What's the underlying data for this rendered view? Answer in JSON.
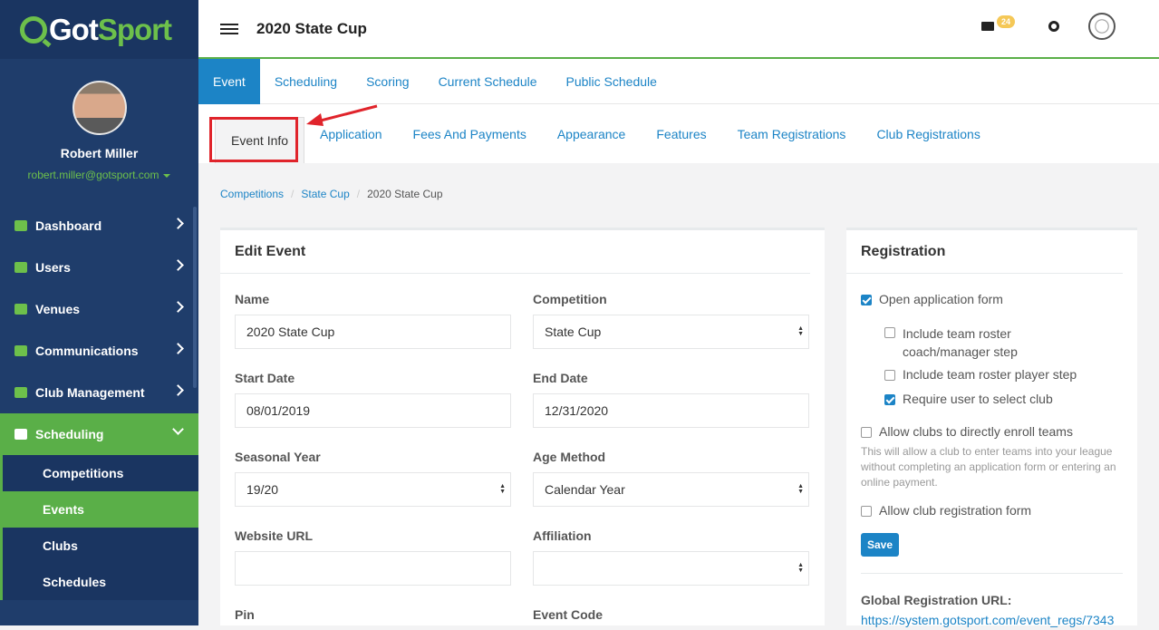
{
  "brand": {
    "got": "Got",
    "sport": "Sport"
  },
  "user": {
    "name": "Robert Miller",
    "email": "robert.miller@gotsport.com"
  },
  "nav": [
    {
      "label": "Dashboard",
      "icon": "dashboard-icon"
    },
    {
      "label": "Users",
      "icon": "users-icon"
    },
    {
      "label": "Venues",
      "icon": "home-icon"
    },
    {
      "label": "Communications",
      "icon": "chat-icon"
    },
    {
      "label": "Club Management",
      "icon": "list-icon"
    },
    {
      "label": "Scheduling",
      "icon": "calendar-icon"
    }
  ],
  "subnav": [
    "Competitions",
    "Events",
    "Clubs",
    "Schedules"
  ],
  "header": {
    "title": "2020 State Cup",
    "mail_count": "24"
  },
  "tabs_primary": [
    "Event",
    "Scheduling",
    "Scoring",
    "Current Schedule",
    "Public Schedule"
  ],
  "tabs_secondary": [
    "Event Info",
    "Application",
    "Fees And Payments",
    "Appearance",
    "Features",
    "Team Registrations",
    "Club Registrations"
  ],
  "breadcrumb": [
    "Competitions",
    "State Cup",
    "2020 State Cup"
  ],
  "edit_event": {
    "title": "Edit Event",
    "name_label": "Name",
    "name_value": "2020 State Cup",
    "competition_label": "Competition",
    "competition_value": "State Cup",
    "start_label": "Start Date",
    "start_value": "08/01/2019",
    "end_label": "End Date",
    "end_value": "12/31/2020",
    "seasonal_label": "Seasonal Year",
    "seasonal_value": "19/20",
    "age_label": "Age Method",
    "age_value": "Calendar Year",
    "website_label": "Website URL",
    "website_value": "",
    "affiliation_label": "Affiliation",
    "affiliation_value": "",
    "pin_label": "Pin",
    "code_label": "Event Code"
  },
  "registration": {
    "title": "Registration",
    "open_form": "Open application form",
    "include_coach": "Include team roster coach/manager step",
    "include_player": "Include team roster player step",
    "require_club": "Require user to select club",
    "allow_enroll": "Allow clubs to directly enroll teams",
    "help": "This will allow a club to enter teams into your league without completing an application form or entering an online payment.",
    "allow_club_form": "Allow club registration form",
    "save": "Save",
    "global_label": "Global Registration URL:",
    "global_url": "https://system.gotsport.com/event_regs/7343"
  }
}
